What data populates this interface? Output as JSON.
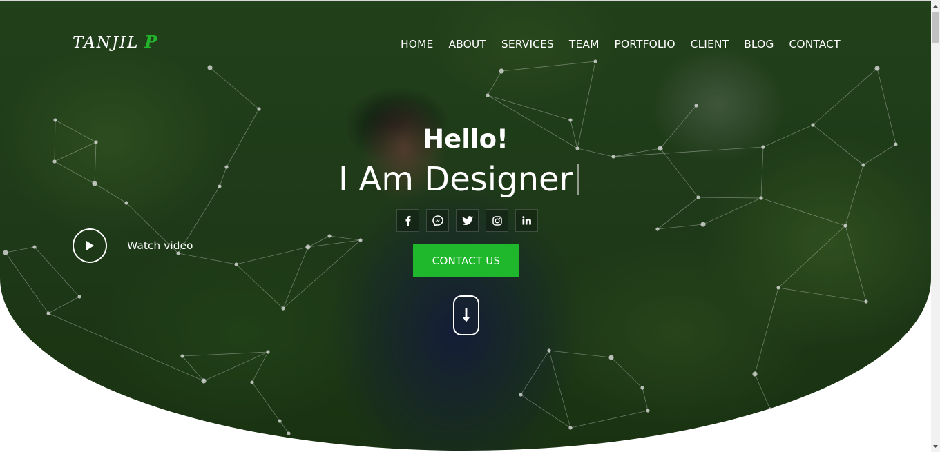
{
  "logo": {
    "main": "TANJIL",
    "accent": "P"
  },
  "nav": {
    "items": [
      {
        "label": "HOME"
      },
      {
        "label": "ABOUT"
      },
      {
        "label": "SERVICES"
      },
      {
        "label": "TEAM"
      },
      {
        "label": "PORTFOLIO"
      },
      {
        "label": "CLIENT"
      },
      {
        "label": "BLOG"
      },
      {
        "label": "CONTACT"
      }
    ]
  },
  "hero": {
    "greeting": "Hello!",
    "typed_text": "I Am Designer",
    "cta_label": "CONTACT US",
    "watch_label": "Watch video"
  },
  "socials": [
    {
      "icon": "facebook-icon"
    },
    {
      "icon": "messenger-icon"
    },
    {
      "icon": "twitter-icon"
    },
    {
      "icon": "instagram-icon"
    },
    {
      "icon": "linkedin-icon"
    }
  ],
  "colors": {
    "accent": "#1fb72b",
    "text": "#ffffff"
  }
}
